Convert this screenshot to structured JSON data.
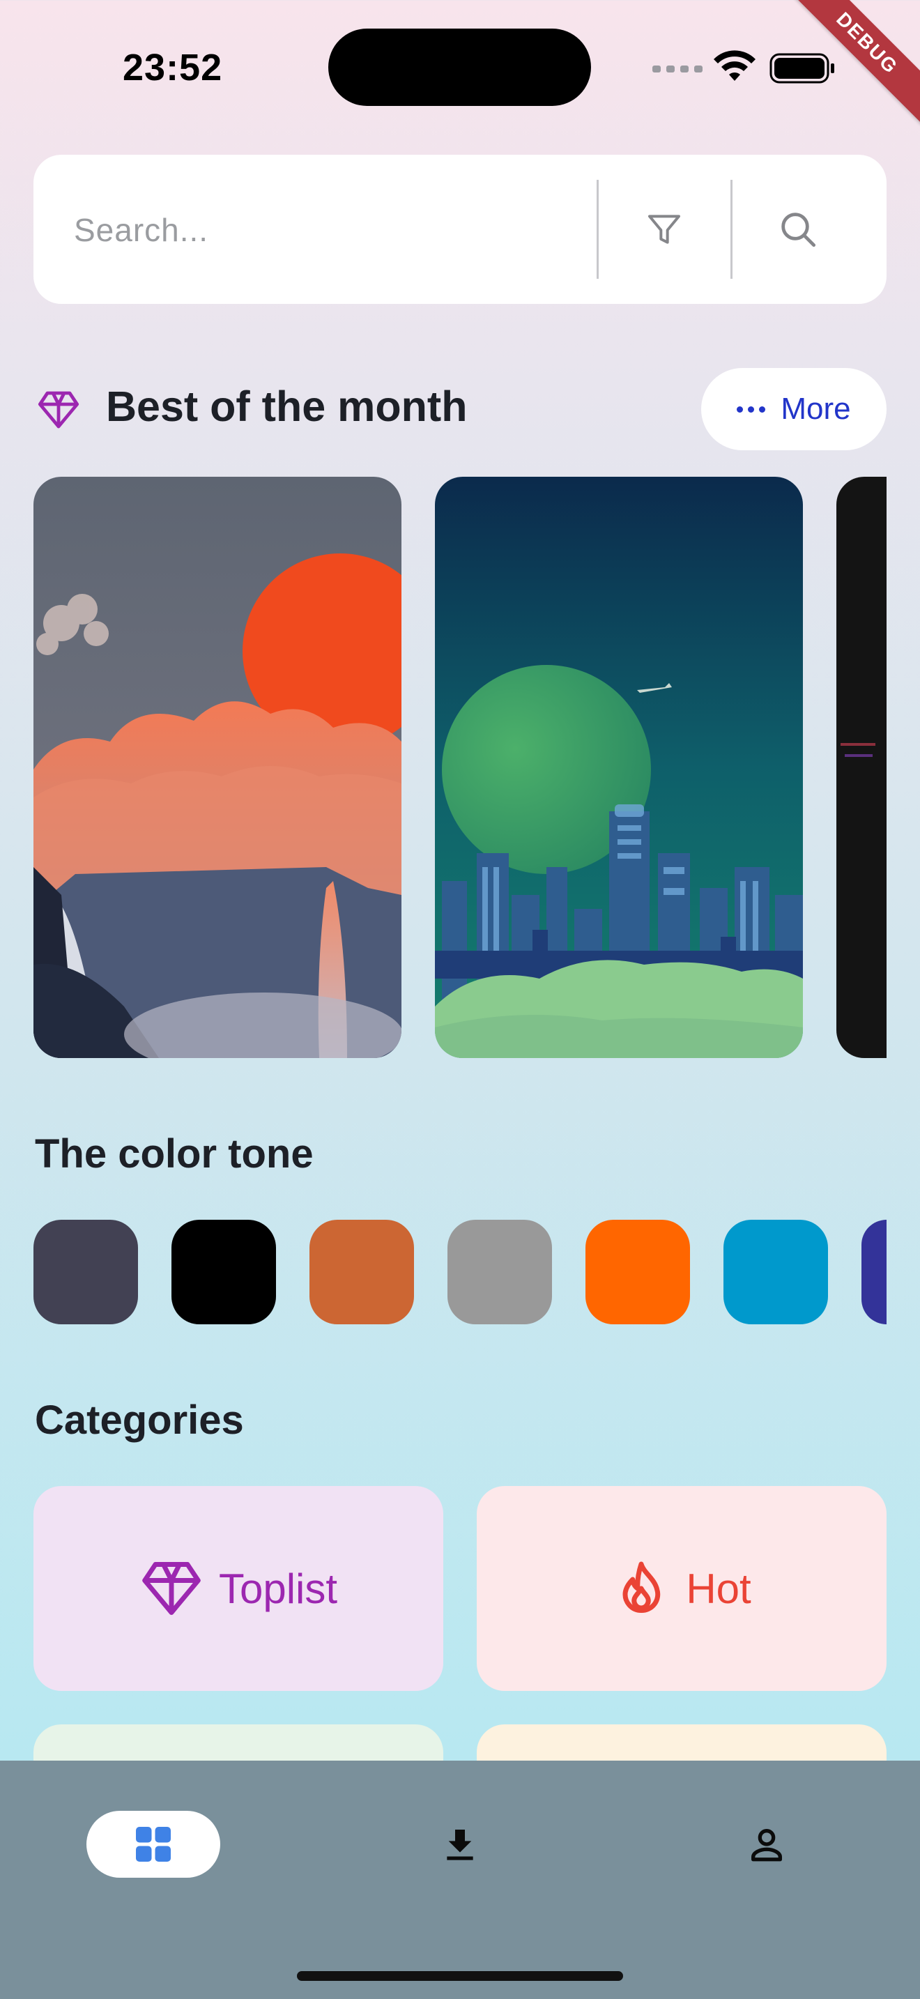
{
  "status_bar": {
    "time": "23:52",
    "debug_label": "DEBUG"
  },
  "search": {
    "placeholder": "Search...",
    "filter_icon": "filter-icon",
    "search_icon": "search-icon"
  },
  "best_of_month": {
    "icon": "diamond-icon",
    "title": "Best of the month",
    "more_label": "More"
  },
  "color_tone": {
    "title": "The color tone",
    "swatches": [
      "#424153",
      "#000000",
      "#cc6633",
      "#999999",
      "#ff6600",
      "#0099cc",
      "#333399"
    ]
  },
  "categories": {
    "title": "Categories",
    "items": [
      {
        "label": "Toplist",
        "icon": "diamond-icon",
        "color": "#9c27b0",
        "background": "#f1e2f4"
      },
      {
        "label": "Hot",
        "icon": "flame-icon",
        "color": "#ea4335",
        "background": "#fde8ea"
      }
    ]
  },
  "bottom_nav": {
    "items": [
      {
        "icon": "grid-icon",
        "active": true
      },
      {
        "icon": "download-icon",
        "active": false
      },
      {
        "icon": "person-icon",
        "active": false
      }
    ]
  }
}
